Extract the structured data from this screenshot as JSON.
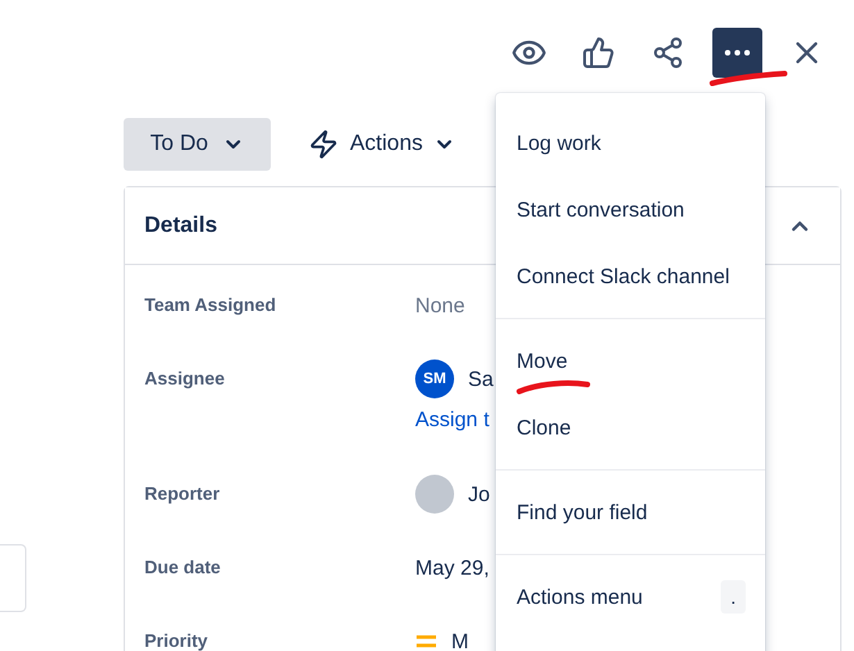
{
  "toolbar": {
    "more_active": true
  },
  "status": {
    "label": "To Do"
  },
  "actions": {
    "label": "Actions"
  },
  "details": {
    "title": "Details",
    "expanded": true,
    "fields": [
      {
        "label": "Team Assigned",
        "kind": "muted",
        "value": "None"
      },
      {
        "label": "Assignee",
        "kind": "user",
        "initials": "SM",
        "value": "Sa",
        "link": "Assign t"
      },
      {
        "label": "Reporter",
        "kind": "photo",
        "value": "Jo"
      },
      {
        "label": "Due date",
        "kind": "text",
        "value": "May 29,"
      },
      {
        "label": "Priority",
        "kind": "priority",
        "value": "M"
      }
    ]
  },
  "menu": {
    "groups": [
      [
        {
          "label": "Log work"
        },
        {
          "label": "Start conversation"
        },
        {
          "label": "Connect Slack channel"
        }
      ],
      [
        {
          "label": "Move"
        },
        {
          "label": "Clone"
        }
      ],
      [
        {
          "label": "Find your field"
        }
      ],
      [
        {
          "label": "Actions menu",
          "shortcut": "."
        }
      ]
    ]
  }
}
